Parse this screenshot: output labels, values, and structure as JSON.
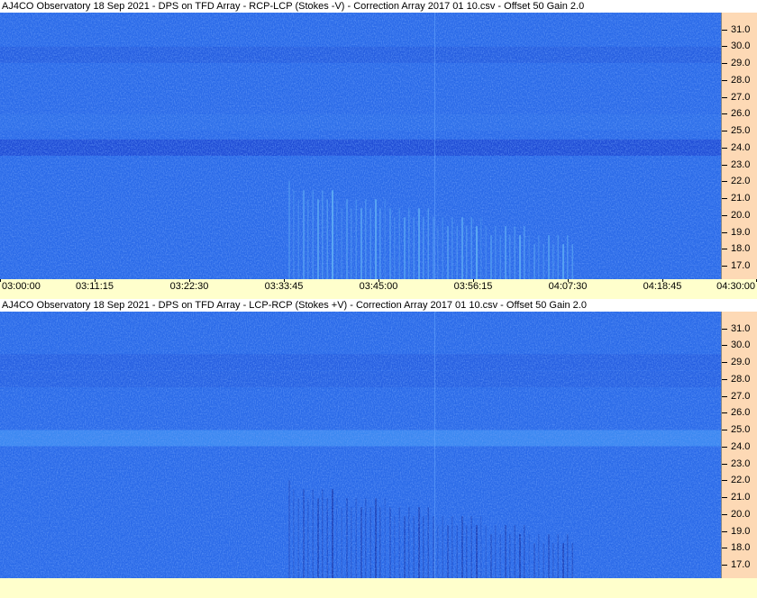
{
  "chart_data": [
    {
      "type": "heatmap",
      "title": "AJ4CO Observatory 18 Sep 2021  -  DPS on TFD Array  -  RCP-LCP (Stokes -V)  -  Correction Array 2017 01 10.csv  -  Offset 50  Gain 2.0",
      "x_tick_labels": [
        "03:00:00",
        "03:11:15",
        "03:22:30",
        "03:33:45",
        "03:45:00",
        "03:56:15",
        "04:07:30",
        "04:18:45",
        "04:30:00"
      ],
      "y_tick_labels": [
        "31.0",
        "30.0",
        "29.0",
        "28.0",
        "27.0",
        "26.0",
        "25.0",
        "24.0",
        "23.0",
        "22.0",
        "21.0",
        "20.0",
        "19.0",
        "18.0",
        "17.0"
      ],
      "ylim": [
        16.2,
        32.0
      ],
      "colormap": [
        "#1838c8",
        "#2a6ae8",
        "#4aa0f8"
      ],
      "features": [
        {
          "freq": 24.0,
          "strength": -0.8
        },
        {
          "freq": 29.5,
          "strength": -0.35
        },
        {
          "freq": 25.5,
          "strength": 0.15
        }
      ],
      "burst": {
        "t_start": 0.4,
        "t_end": 0.8,
        "f_low": 16.2,
        "f_high": 22.0,
        "polarity": 1
      }
    },
    {
      "type": "heatmap",
      "title": "AJ4CO Observatory 18 Sep 2021  -  DPS on TFD Array  -  LCP-RCP (Stokes +V)  -  Correction Array 2017 01 10.csv  -  Offset 50  Gain 2.0",
      "x_tick_labels": [],
      "y_tick_labels": [
        "31.0",
        "30.0",
        "29.0",
        "28.0",
        "27.0",
        "26.0",
        "25.0",
        "24.0",
        "23.0",
        "22.0",
        "21.0",
        "20.0",
        "19.0",
        "18.0",
        "17.0"
      ],
      "ylim": [
        16.2,
        32.0
      ],
      "colormap": [
        "#1838c8",
        "#2a6ae8",
        "#4aa0f8"
      ],
      "features": [
        {
          "freq": 24.5,
          "strength": 0.8
        },
        {
          "freq": 29.0,
          "strength": -0.3
        },
        {
          "freq": 28.0,
          "strength": -0.25
        }
      ],
      "burst": {
        "t_start": 0.4,
        "t_end": 0.8,
        "f_low": 16.2,
        "f_high": 22.0,
        "polarity": -1
      }
    }
  ]
}
